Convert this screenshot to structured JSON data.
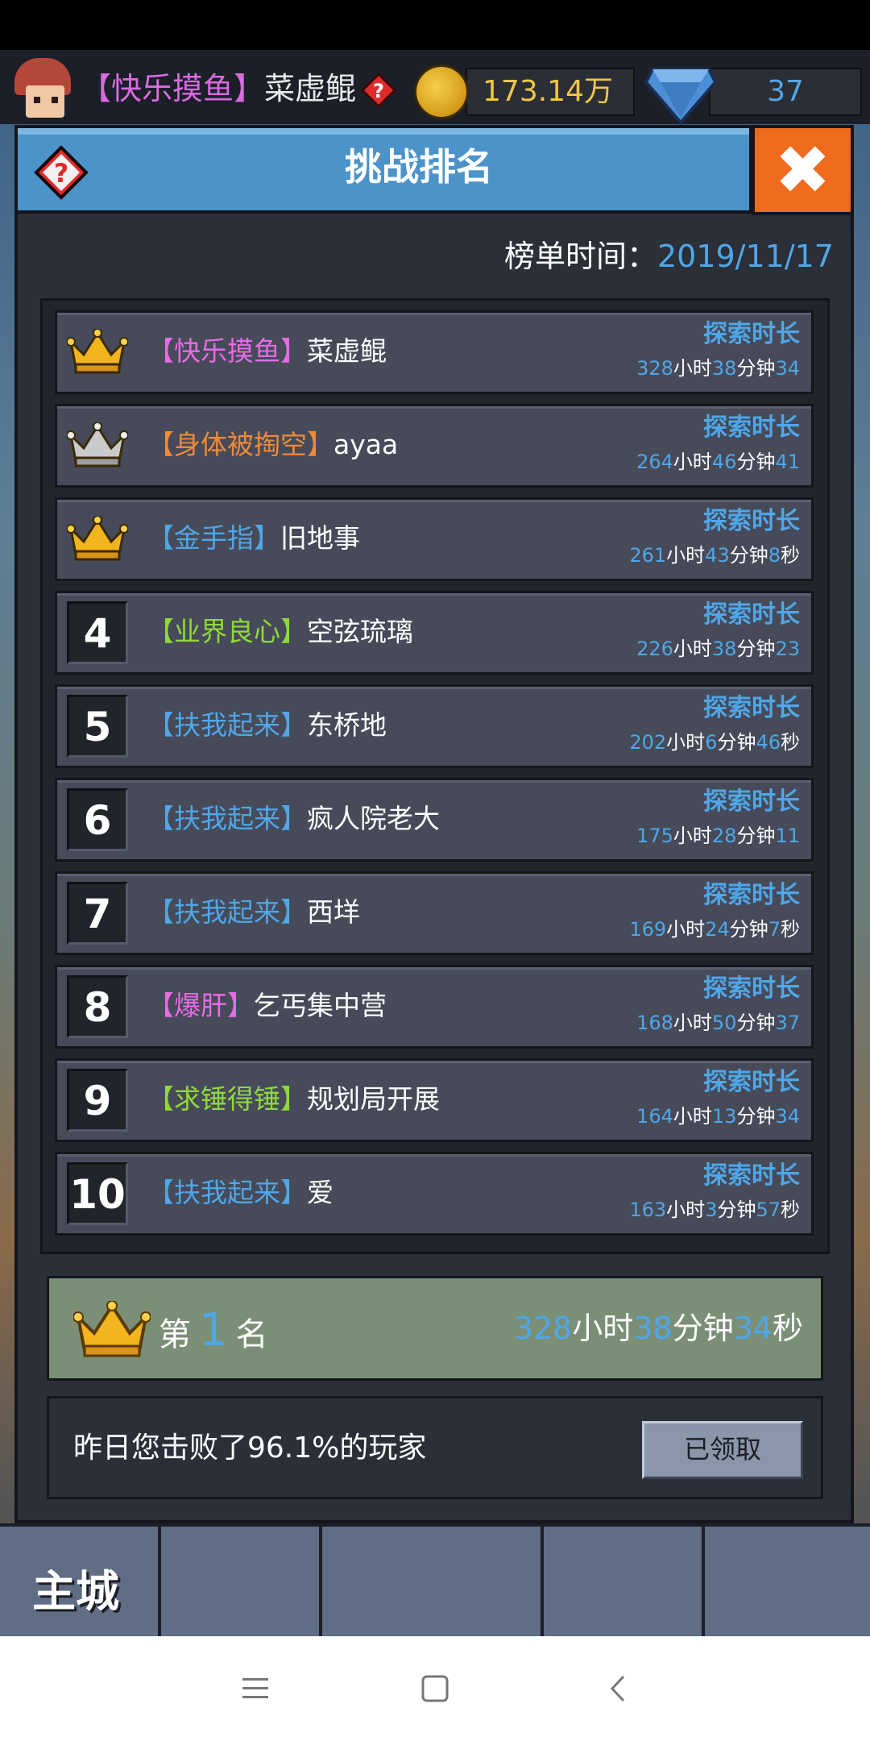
{
  "topbar": {
    "guild": "【快乐摸鱼】",
    "nickname": "菜虚鲲",
    "coins": "173.14万",
    "gems": "37"
  },
  "dialog": {
    "title": "挑战排名",
    "board_time_label": "榜单时间：",
    "board_time_value": "2019/11/17"
  },
  "rankings": [
    {
      "rank": "1",
      "guild": "【快乐摸鱼】",
      "guild_color": "#e86be6",
      "name": "菜虚鲲",
      "label": "探索时长",
      "h": "328",
      "m": "38",
      "s": "34",
      "s_unit": ""
    },
    {
      "rank": "2",
      "guild": "【身体被掏空】",
      "guild_color": "#f08a38",
      "name": "ayaa",
      "label": "探索时长",
      "h": "264",
      "m": "46",
      "s": "41",
      "s_unit": ""
    },
    {
      "rank": "3",
      "guild": "【金手指】",
      "guild_color": "#4fa7e8",
      "name": "旧地事",
      "label": "探索时长",
      "h": "261",
      "m": "43",
      "s": "8",
      "s_unit": "秒"
    },
    {
      "rank": "4",
      "guild": "【业界良心】",
      "guild_color": "#8fd93c",
      "name": "空弦琉璃",
      "label": "探索时长",
      "h": "226",
      "m": "38",
      "s": "23",
      "s_unit": ""
    },
    {
      "rank": "5",
      "guild": "【扶我起来】",
      "guild_color": "#4fa7e8",
      "name": "东桥地",
      "label": "探索时长",
      "h": "202",
      "m": "6",
      "s": "46",
      "s_unit": "秒"
    },
    {
      "rank": "6",
      "guild": "【扶我起来】",
      "guild_color": "#4fa7e8",
      "name": "疯人院老大",
      "label": "探索时长",
      "h": "175",
      "m": "28",
      "s": "11",
      "s_unit": ""
    },
    {
      "rank": "7",
      "guild": "【扶我起来】",
      "guild_color": "#4fa7e8",
      "name": "西垟",
      "label": "探索时长",
      "h": "169",
      "m": "24",
      "s": "7",
      "s_unit": "秒"
    },
    {
      "rank": "8",
      "guild": "【爆肝】",
      "guild_color": "#e86be6",
      "name": "乞丐集中营",
      "label": "探索时长",
      "h": "168",
      "m": "50",
      "s": "37",
      "s_unit": ""
    },
    {
      "rank": "9",
      "guild": "【求锤得锤】",
      "guild_color": "#8fd93c",
      "name": "规划局开展",
      "label": "探索时长",
      "h": "164",
      "m": "13",
      "s": "34",
      "s_unit": ""
    },
    {
      "rank": "10",
      "guild": "【扶我起来】",
      "guild_color": "#4fa7e8",
      "name": "爱",
      "label": "探索时长",
      "h": "163",
      "m": "3",
      "s": "57",
      "s_unit": "秒"
    }
  ],
  "time_units": {
    "hour": "小时",
    "minute": "分钟",
    "second": "秒"
  },
  "my_rank": {
    "prefix": "第",
    "rank": "1",
    "suffix": "名",
    "h": "328",
    "m": "38",
    "s": "34"
  },
  "defeat": {
    "text": "昨日您击败了96.1%的玩家",
    "button": "已领取"
  },
  "nav": {
    "main_city": "主城"
  },
  "colors": {
    "gold_crown": "#f2b51d",
    "silver_crown": "#c8cacc",
    "accent_blue": "#4fa7e8",
    "close_orange": "#f06a1e"
  }
}
